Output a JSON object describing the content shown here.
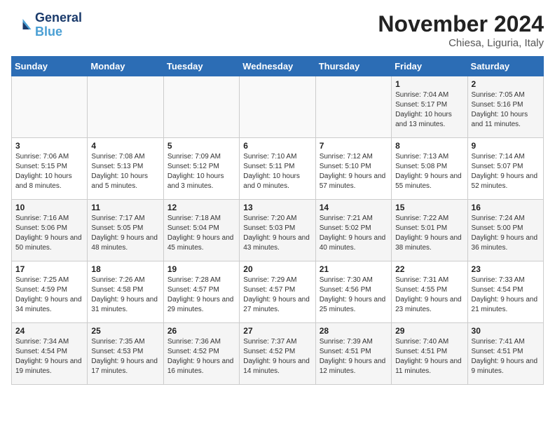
{
  "header": {
    "logo_line1": "General",
    "logo_line2": "Blue",
    "month": "November 2024",
    "location": "Chiesa, Liguria, Italy"
  },
  "weekdays": [
    "Sunday",
    "Monday",
    "Tuesday",
    "Wednesday",
    "Thursday",
    "Friday",
    "Saturday"
  ],
  "weeks": [
    [
      {
        "day": "",
        "info": ""
      },
      {
        "day": "",
        "info": ""
      },
      {
        "day": "",
        "info": ""
      },
      {
        "day": "",
        "info": ""
      },
      {
        "day": "",
        "info": ""
      },
      {
        "day": "1",
        "info": "Sunrise: 7:04 AM\nSunset: 5:17 PM\nDaylight: 10 hours and 13 minutes."
      },
      {
        "day": "2",
        "info": "Sunrise: 7:05 AM\nSunset: 5:16 PM\nDaylight: 10 hours and 11 minutes."
      }
    ],
    [
      {
        "day": "3",
        "info": "Sunrise: 7:06 AM\nSunset: 5:15 PM\nDaylight: 10 hours and 8 minutes."
      },
      {
        "day": "4",
        "info": "Sunrise: 7:08 AM\nSunset: 5:13 PM\nDaylight: 10 hours and 5 minutes."
      },
      {
        "day": "5",
        "info": "Sunrise: 7:09 AM\nSunset: 5:12 PM\nDaylight: 10 hours and 3 minutes."
      },
      {
        "day": "6",
        "info": "Sunrise: 7:10 AM\nSunset: 5:11 PM\nDaylight: 10 hours and 0 minutes."
      },
      {
        "day": "7",
        "info": "Sunrise: 7:12 AM\nSunset: 5:10 PM\nDaylight: 9 hours and 57 minutes."
      },
      {
        "day": "8",
        "info": "Sunrise: 7:13 AM\nSunset: 5:08 PM\nDaylight: 9 hours and 55 minutes."
      },
      {
        "day": "9",
        "info": "Sunrise: 7:14 AM\nSunset: 5:07 PM\nDaylight: 9 hours and 52 minutes."
      }
    ],
    [
      {
        "day": "10",
        "info": "Sunrise: 7:16 AM\nSunset: 5:06 PM\nDaylight: 9 hours and 50 minutes."
      },
      {
        "day": "11",
        "info": "Sunrise: 7:17 AM\nSunset: 5:05 PM\nDaylight: 9 hours and 48 minutes."
      },
      {
        "day": "12",
        "info": "Sunrise: 7:18 AM\nSunset: 5:04 PM\nDaylight: 9 hours and 45 minutes."
      },
      {
        "day": "13",
        "info": "Sunrise: 7:20 AM\nSunset: 5:03 PM\nDaylight: 9 hours and 43 minutes."
      },
      {
        "day": "14",
        "info": "Sunrise: 7:21 AM\nSunset: 5:02 PM\nDaylight: 9 hours and 40 minutes."
      },
      {
        "day": "15",
        "info": "Sunrise: 7:22 AM\nSunset: 5:01 PM\nDaylight: 9 hours and 38 minutes."
      },
      {
        "day": "16",
        "info": "Sunrise: 7:24 AM\nSunset: 5:00 PM\nDaylight: 9 hours and 36 minutes."
      }
    ],
    [
      {
        "day": "17",
        "info": "Sunrise: 7:25 AM\nSunset: 4:59 PM\nDaylight: 9 hours and 34 minutes."
      },
      {
        "day": "18",
        "info": "Sunrise: 7:26 AM\nSunset: 4:58 PM\nDaylight: 9 hours and 31 minutes."
      },
      {
        "day": "19",
        "info": "Sunrise: 7:28 AM\nSunset: 4:57 PM\nDaylight: 9 hours and 29 minutes."
      },
      {
        "day": "20",
        "info": "Sunrise: 7:29 AM\nSunset: 4:57 PM\nDaylight: 9 hours and 27 minutes."
      },
      {
        "day": "21",
        "info": "Sunrise: 7:30 AM\nSunset: 4:56 PM\nDaylight: 9 hours and 25 minutes."
      },
      {
        "day": "22",
        "info": "Sunrise: 7:31 AM\nSunset: 4:55 PM\nDaylight: 9 hours and 23 minutes."
      },
      {
        "day": "23",
        "info": "Sunrise: 7:33 AM\nSunset: 4:54 PM\nDaylight: 9 hours and 21 minutes."
      }
    ],
    [
      {
        "day": "24",
        "info": "Sunrise: 7:34 AM\nSunset: 4:54 PM\nDaylight: 9 hours and 19 minutes."
      },
      {
        "day": "25",
        "info": "Sunrise: 7:35 AM\nSunset: 4:53 PM\nDaylight: 9 hours and 17 minutes."
      },
      {
        "day": "26",
        "info": "Sunrise: 7:36 AM\nSunset: 4:52 PM\nDaylight: 9 hours and 16 minutes."
      },
      {
        "day": "27",
        "info": "Sunrise: 7:37 AM\nSunset: 4:52 PM\nDaylight: 9 hours and 14 minutes."
      },
      {
        "day": "28",
        "info": "Sunrise: 7:39 AM\nSunset: 4:51 PM\nDaylight: 9 hours and 12 minutes."
      },
      {
        "day": "29",
        "info": "Sunrise: 7:40 AM\nSunset: 4:51 PM\nDaylight: 9 hours and 11 minutes."
      },
      {
        "day": "30",
        "info": "Sunrise: 7:41 AM\nSunset: 4:51 PM\nDaylight: 9 hours and 9 minutes."
      }
    ]
  ]
}
